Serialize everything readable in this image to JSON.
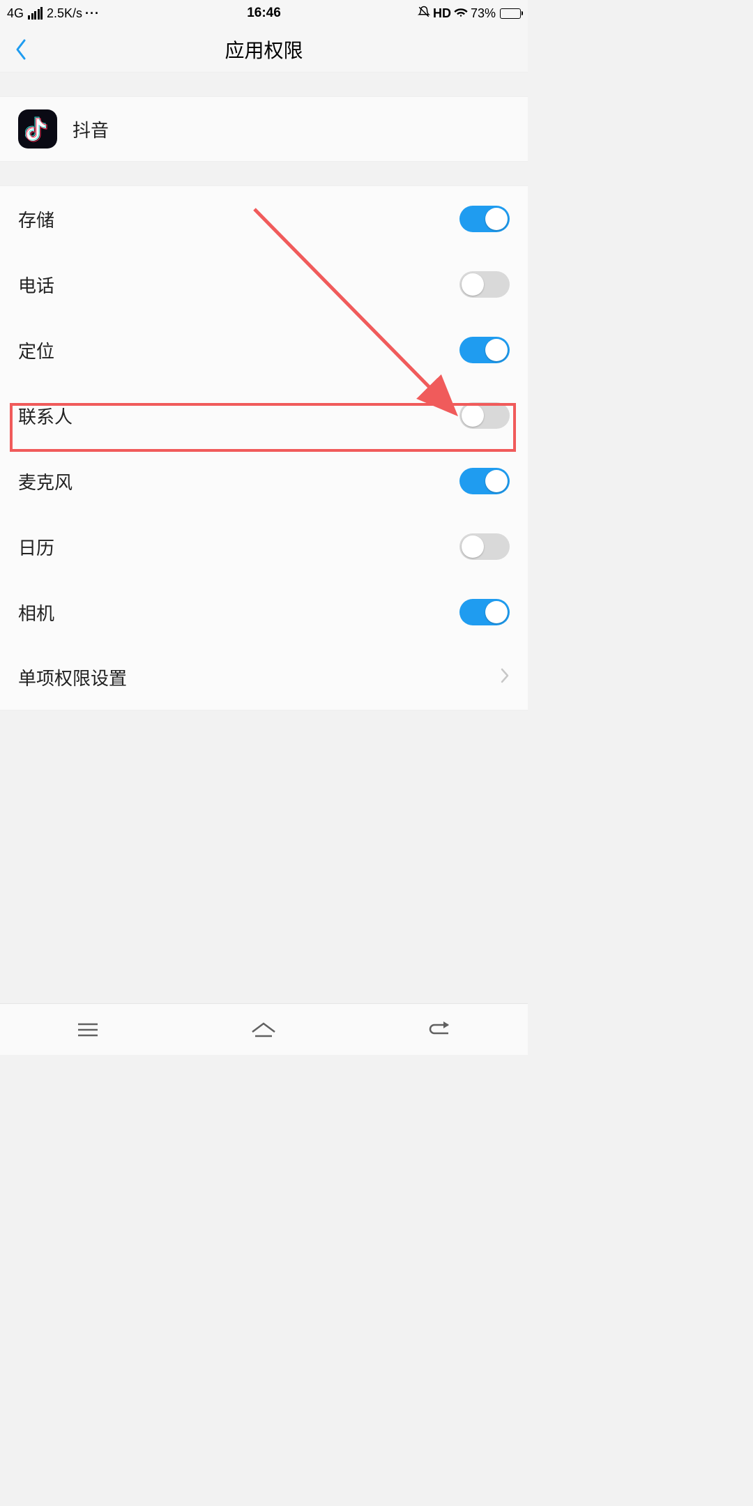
{
  "status_bar": {
    "network_type": "4G",
    "speed": "2.5K/s",
    "dots": "···",
    "time": "16:46",
    "hd": "HD",
    "battery_percent": "73%"
  },
  "header": {
    "title": "应用权限"
  },
  "app": {
    "name": "抖音"
  },
  "permissions": [
    {
      "label": "存储",
      "on": true
    },
    {
      "label": "电话",
      "on": false
    },
    {
      "label": "定位",
      "on": true
    },
    {
      "label": "联系人",
      "on": false
    },
    {
      "label": "麦克风",
      "on": true
    },
    {
      "label": "日历",
      "on": false
    },
    {
      "label": "相机",
      "on": true
    }
  ],
  "more_link": {
    "label": "单项权限设置"
  },
  "highlight_index": 4
}
